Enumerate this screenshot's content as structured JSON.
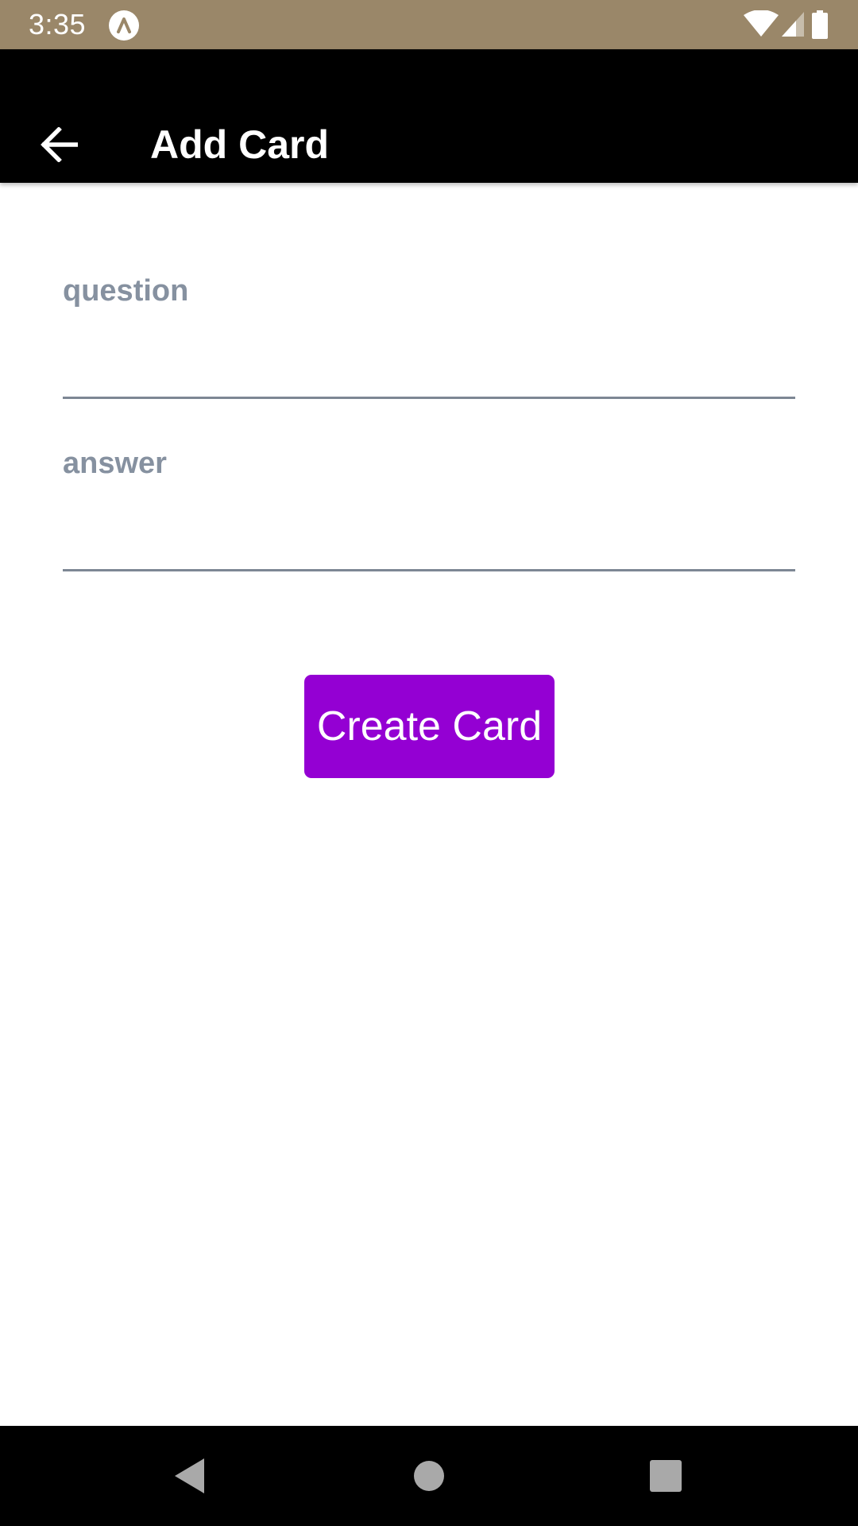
{
  "status_bar": {
    "time": "3:35",
    "background_color": "#9a8769",
    "icons": [
      "notification-app-icon",
      "wifi-icon",
      "cellular-signal-icon",
      "battery-icon"
    ]
  },
  "app_bar": {
    "title": "Add Card",
    "back_icon": "arrow-left-icon",
    "background_color": "#000000"
  },
  "form": {
    "question": {
      "label": "question",
      "value": ""
    },
    "answer": {
      "label": "answer",
      "value": ""
    },
    "submit_label": "Create Card",
    "label_color": "#8691a0",
    "accent_color": "#9400d3"
  },
  "nav_bar": {
    "icons": [
      "back-triangle-icon",
      "home-circle-icon",
      "recents-square-icon"
    ]
  }
}
